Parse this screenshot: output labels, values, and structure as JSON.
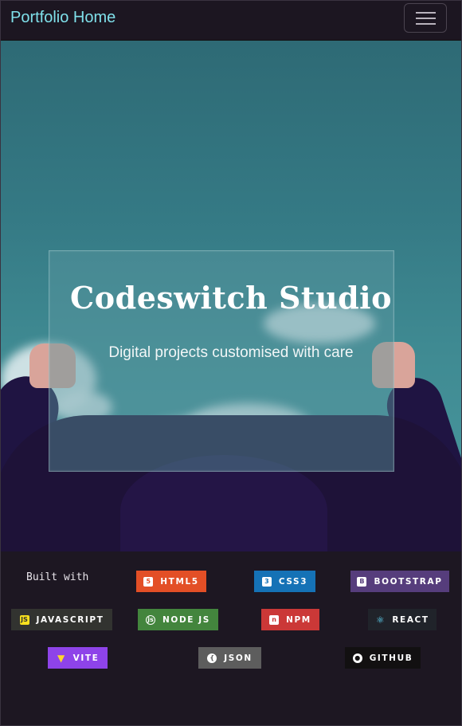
{
  "navbar": {
    "brand": "Portfolio Home",
    "toggle_icon": "hamburger-menu-icon"
  },
  "hero": {
    "title": "Codeswitch Studio",
    "subtitle": "Digital projects customised with care"
  },
  "footer": {
    "built_with": "Built with",
    "badges": [
      {
        "label": "HTML5",
        "icon": "html5-icon",
        "color": "#e34f26"
      },
      {
        "label": "CSS3",
        "icon": "css3-icon",
        "color": "#1572b6"
      },
      {
        "label": "BOOTSTRAP",
        "icon": "bootstrap-icon",
        "color": "#563d7c"
      },
      {
        "label": "JAVASCRIPT",
        "icon": "javascript-icon",
        "color": "#323330"
      },
      {
        "label": "NODE JS",
        "icon": "nodejs-icon",
        "color": "#43853d"
      },
      {
        "label": "NPM",
        "icon": "npm-icon",
        "color": "#cb3837"
      },
      {
        "label": "REACT",
        "icon": "react-icon",
        "color": "#20232a"
      },
      {
        "label": "VITE",
        "icon": "vite-icon",
        "color": "#8e43e9"
      },
      {
        "label": "JSON",
        "icon": "json-icon",
        "color": "#5d5d5d"
      },
      {
        "label": "GITHUB",
        "icon": "github-icon",
        "color": "#121011"
      }
    ]
  }
}
